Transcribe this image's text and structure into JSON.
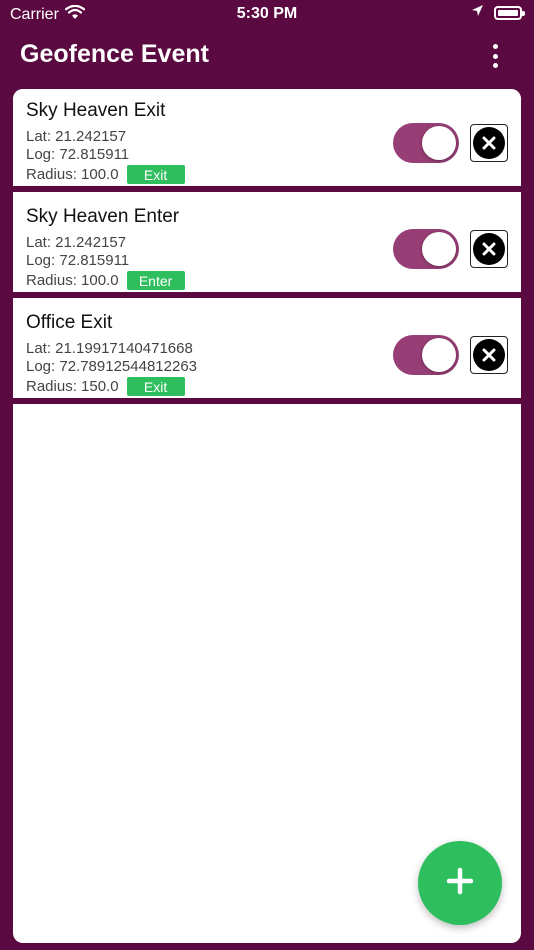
{
  "status_bar": {
    "carrier": "Carrier",
    "time": "5:30 PM",
    "wifi_icon": "wifi-icon",
    "location_icon": "location-arrow-icon",
    "battery_icon": "battery-icon"
  },
  "app_bar": {
    "title": "Geofence Event",
    "menu_icon": "more-vertical-icon"
  },
  "colors": {
    "background": "#5a0a40",
    "toggle_on": "#963e75",
    "badge": "#2fbe5e",
    "fab": "#2fbe5e"
  },
  "events": [
    {
      "name": "Sky Heaven Exit",
      "lat": "Lat: 21.242157",
      "log": "Log: 72.815911",
      "radius": "Radius: 100.0",
      "type": "Exit",
      "enabled": true
    },
    {
      "name": "Sky Heaven Enter",
      "lat": "Lat: 21.242157",
      "log": "Log: 72.815911",
      "radius": "Radius: 100.0",
      "type": "Enter",
      "enabled": true
    },
    {
      "name": "Office Exit",
      "lat": "Lat: 21.19917140471668",
      "log": "Log: 72.78912544812263",
      "radius": "Radius: 150.0",
      "type": "Exit",
      "enabled": true
    }
  ],
  "fab": {
    "icon": "plus-icon"
  }
}
